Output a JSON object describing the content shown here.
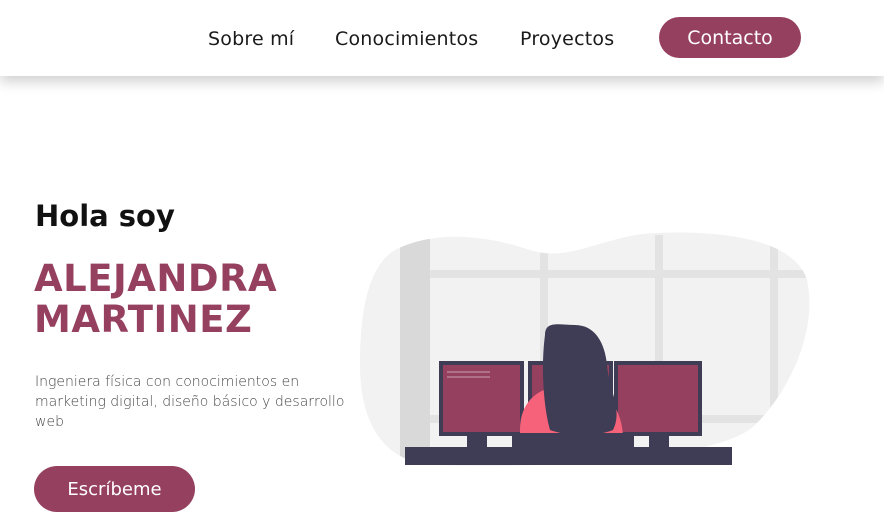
{
  "nav": {
    "links": [
      {
        "label": "Sobre mí"
      },
      {
        "label": "Conocimientos"
      },
      {
        "label": "Proyectos"
      }
    ],
    "contact_label": "Contacto"
  },
  "hero": {
    "greeting": "Hola soy",
    "name_line1": "ALEJANDRA",
    "name_line2": "MARTINEZ",
    "description": "Ingeniera física con conocimientos en marketing digital, diseño básico y desarrollo web",
    "cta_label": "Escríbeme"
  },
  "colors": {
    "accent": "#96405f",
    "text": "#111111",
    "blob": "#f2f2f2"
  },
  "icons": {
    "illustration": "woman-at-computer-illustration"
  }
}
